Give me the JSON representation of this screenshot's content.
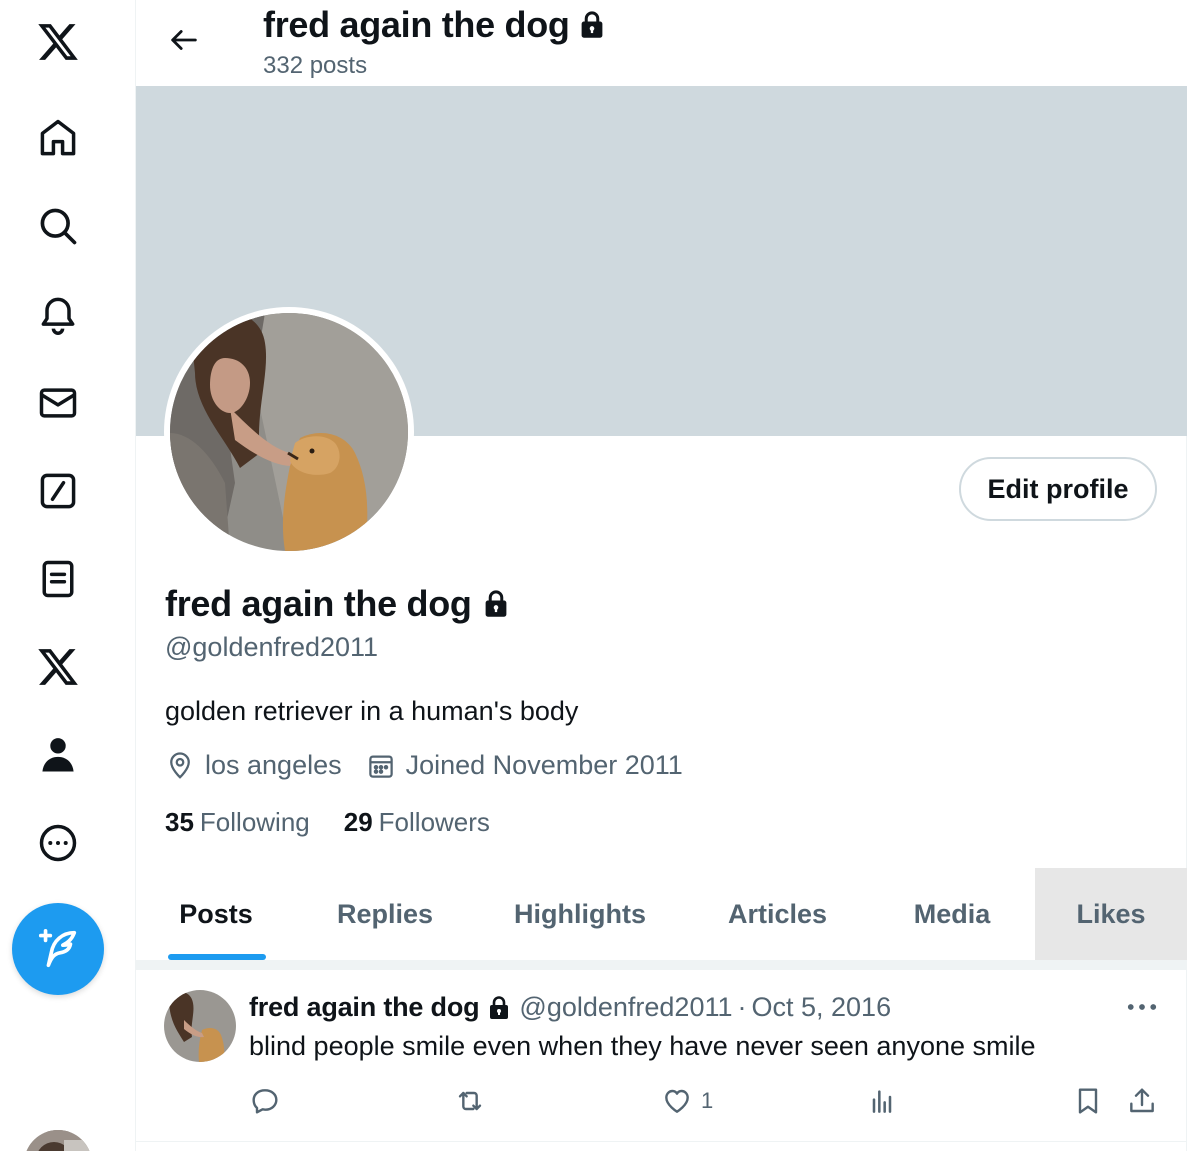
{
  "nav": {
    "items": [
      "x-logo",
      "home",
      "explore",
      "notifications",
      "messages",
      "grok",
      "lists",
      "premium",
      "profile",
      "more"
    ]
  },
  "header": {
    "title": "fred again the dog",
    "posts_count": "332 posts"
  },
  "profile": {
    "edit_label": "Edit profile",
    "name": "fred again the dog",
    "handle": "@goldenfred2011",
    "bio": "golden retriever in a human's body",
    "location": "los angeles",
    "joined": "Joined November 2011",
    "following_count": "35",
    "following_label": "Following",
    "followers_count": "29",
    "followers_label": "Followers"
  },
  "tabs": [
    {
      "label": "Posts"
    },
    {
      "label": "Replies"
    },
    {
      "label": "Highlights"
    },
    {
      "label": "Articles"
    },
    {
      "label": "Media"
    },
    {
      "label": "Likes"
    }
  ],
  "post": {
    "name": "fred again the dog",
    "handle": "@goldenfred2011",
    "sep": "·",
    "date": "Oct 5, 2016",
    "text": "blind people smile even when they have never seen anyone smile",
    "likes": "1"
  },
  "colors": {
    "accent": "#1d9bf0",
    "banner": "#cfd9de",
    "secondary_text": "#536471"
  }
}
